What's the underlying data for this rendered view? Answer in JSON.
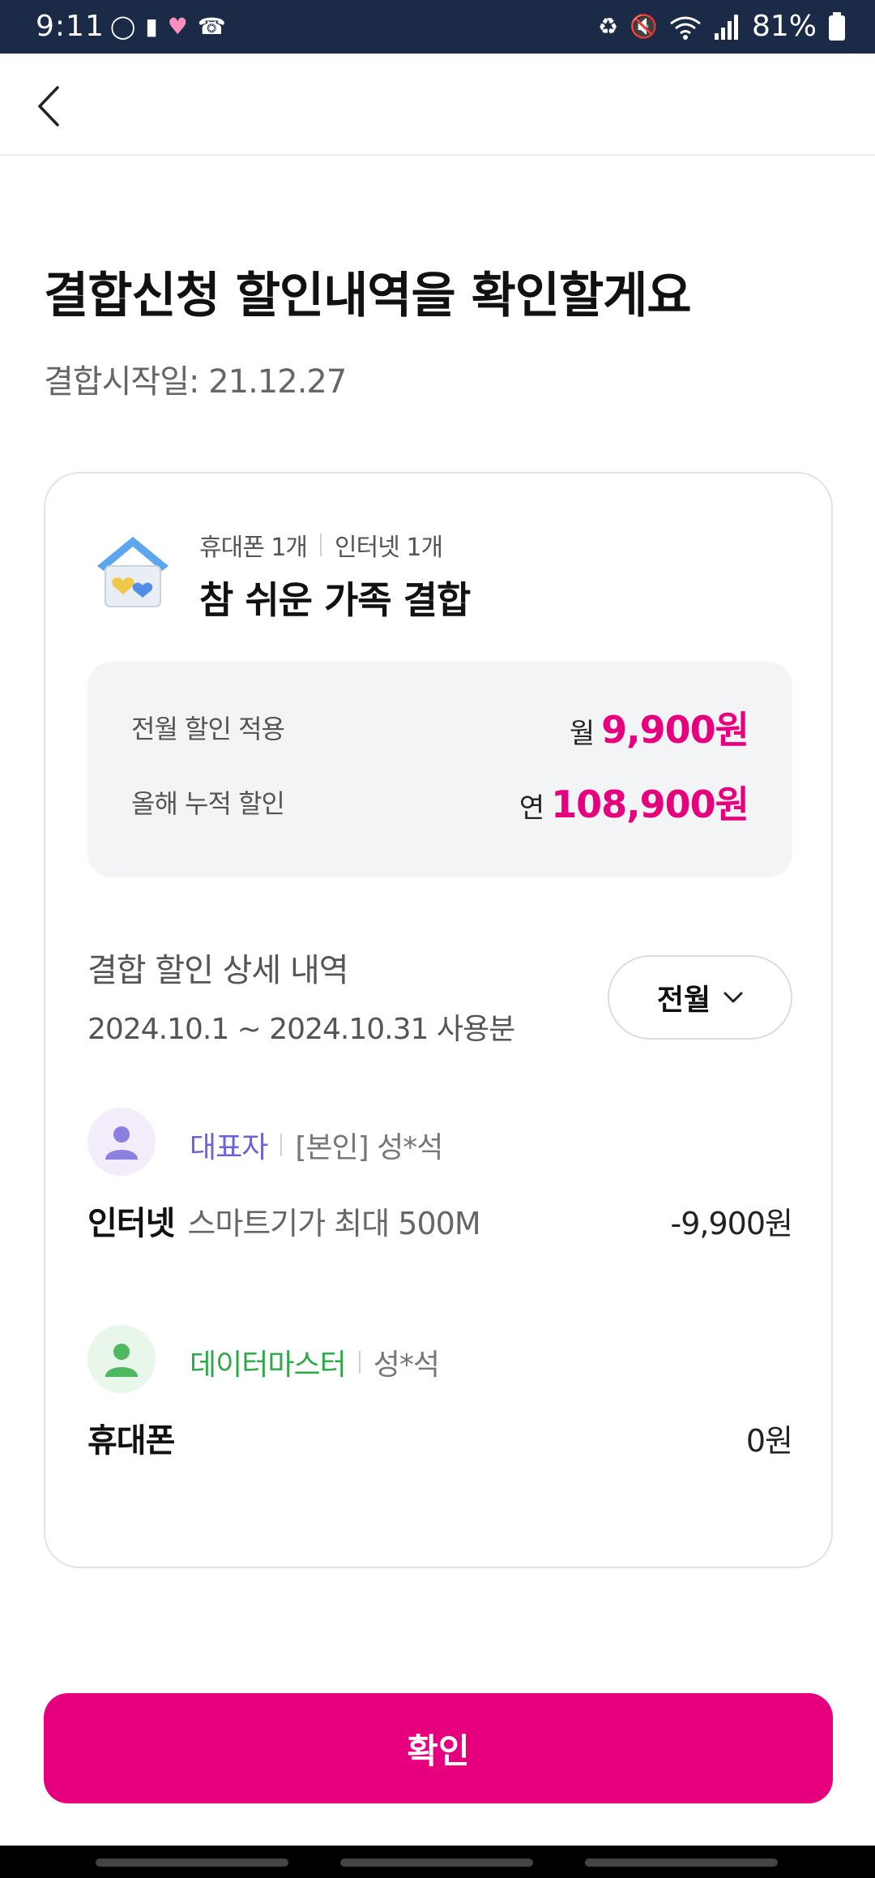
{
  "status_bar": {
    "time": "9:11",
    "battery": "81%",
    "left_icons": [
      "ring-icon",
      "bottle-icon",
      "heart-icon",
      "whowho-call-icon"
    ],
    "right_icons": [
      "battery-saver-icon",
      "mute-icon",
      "wifi-icon",
      "signal-icon",
      "battery-icon"
    ]
  },
  "header": {
    "back_icon": "chevron-left-icon"
  },
  "page": {
    "title": "결합신청 할인내역을 확인할게요",
    "start_date": "결합시작일: 21.12.27"
  },
  "card": {
    "tags": [
      "휴대폰 1개",
      "인터넷 1개"
    ],
    "plan_name": "참 쉬운 가족 결합",
    "summary": {
      "row1_label": "전월 할인 적용",
      "row1_prefix": "월",
      "row1_amount": "9,900원",
      "row2_label": "올해 누적 할인",
      "row2_prefix": "연",
      "row2_amount": "108,900원"
    },
    "detail": {
      "title": "결합 할인 상세 내역",
      "period": "2024.10.1 ~ 2024.10.31 사용분",
      "month_select": "전월"
    },
    "members": [
      {
        "role": "대표자",
        "name": "[본인] 성*석",
        "service_type": "인터넷",
        "service_plan": "스마트기가 최대 500M",
        "amount": "-9,900원",
        "avatar_color": "#8b7fe0"
      },
      {
        "role": "데이터마스터",
        "name": "성*석",
        "service_type": "휴대폰",
        "service_plan": "",
        "amount": "0원",
        "avatar_color": "#4fb95f"
      }
    ]
  },
  "footer": {
    "confirm_label": "확인"
  },
  "colors": {
    "accent": "#e6007e",
    "status_bar_bg": "#1b2a47"
  }
}
